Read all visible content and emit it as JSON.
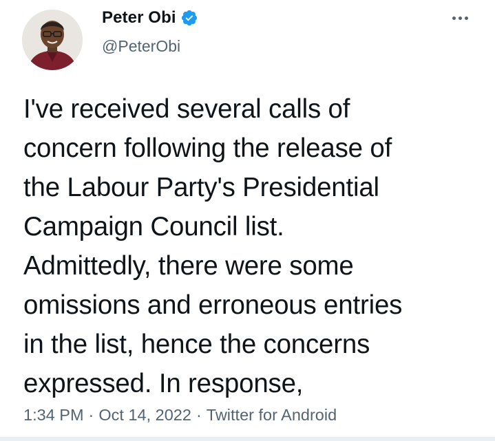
{
  "author": {
    "display_name": "Peter Obi",
    "handle": "@PeterObi",
    "verified": true,
    "verified_color": "#1d9bf0"
  },
  "icons": {
    "verified": "verified-badge-icon",
    "more": "more-options-icon",
    "avatar": "profile-photo"
  },
  "tweet": {
    "lines": [
      "I've received several calls of",
      "concern following the release of",
      "the Labour Party's Presidential",
      "Campaign Council list.",
      "Admittedly, there were some",
      "omissions and erroneous entries",
      "in the list, hence the concerns",
      "expressed. In response,"
    ]
  },
  "meta": {
    "time": "1:34 PM",
    "separator": "·",
    "date": "Oct 14, 2022",
    "source": "Twitter for Android"
  }
}
